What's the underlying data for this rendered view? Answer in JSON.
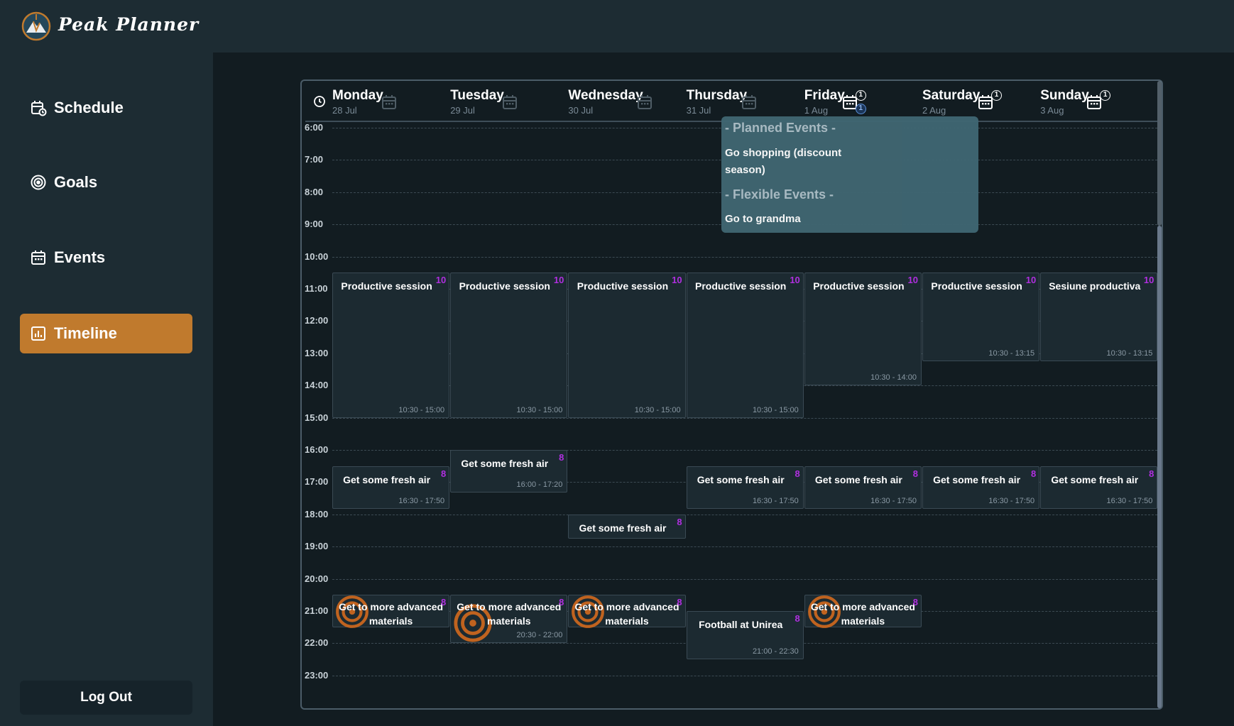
{
  "app": {
    "brand": "Peak Planner"
  },
  "sidebar": {
    "items": [
      {
        "label": "Schedule",
        "icon": "calendar-clock-icon",
        "active": false
      },
      {
        "label": "Goals",
        "icon": "target-icon",
        "active": false
      },
      {
        "label": "Events",
        "icon": "calendar-icon",
        "active": false
      },
      {
        "label": "Timeline",
        "icon": "chart-icon",
        "active": true
      }
    ],
    "logout_label": "Log Out"
  },
  "timeline": {
    "days": [
      {
        "name": "Monday",
        "date": "28 Jul",
        "badge": ""
      },
      {
        "name": "Tuesday",
        "date": "29 Jul",
        "badge": ""
      },
      {
        "name": "Wednesday",
        "date": "30 Jul",
        "badge": ""
      },
      {
        "name": "Thursday",
        "date": "31 Jul",
        "badge": ""
      },
      {
        "name": "Friday",
        "date": "1 Aug",
        "badge": "1",
        "badge2": "1"
      },
      {
        "name": "Saturday",
        "date": "2 Aug",
        "badge": "1"
      },
      {
        "name": "Sunday",
        "date": "3 Aug",
        "badge": "1"
      }
    ],
    "hours": [
      "6:00",
      "7:00",
      "8:00",
      "9:00",
      "10:00",
      "11:00",
      "12:00",
      "13:00",
      "14:00",
      "15:00",
      "16:00",
      "17:00",
      "18:00",
      "19:00",
      "20:00",
      "21:00",
      "22:00",
      "23:00"
    ],
    "events": [
      {
        "day": 0,
        "start": 10.5,
        "end": 15.0,
        "title": "Productive session",
        "priority": "10",
        "time": "10:30 - 15:00"
      },
      {
        "day": 1,
        "start": 10.5,
        "end": 15.0,
        "title": "Productive session",
        "priority": "10",
        "time": "10:30 - 15:00"
      },
      {
        "day": 2,
        "start": 10.5,
        "end": 15.0,
        "title": "Productive session",
        "priority": "10",
        "time": "10:30 - 15:00"
      },
      {
        "day": 3,
        "start": 10.5,
        "end": 15.0,
        "title": "Productive session",
        "priority": "10",
        "time": "10:30 - 15:00"
      },
      {
        "day": 4,
        "start": 10.5,
        "end": 14.0,
        "title": "Productive session",
        "priority": "10",
        "time": "10:30 - 14:00"
      },
      {
        "day": 5,
        "start": 10.5,
        "end": 13.25,
        "title": "Productive session",
        "priority": "10",
        "time": "10:30 - 13:15"
      },
      {
        "day": 6,
        "start": 10.5,
        "end": 13.25,
        "title": "Sesiune productiva",
        "priority": "10",
        "time": "10:30 - 13:15"
      },
      {
        "day": 0,
        "start": 16.5,
        "end": 17.83,
        "title": "Get some fresh air",
        "priority": "8",
        "time": "16:30 - 17:50"
      },
      {
        "day": 1,
        "start": 16.0,
        "end": 17.33,
        "title": "Get some fresh air",
        "priority": "8",
        "time": "16:00 - 17:20"
      },
      {
        "day": 2,
        "start": 18.0,
        "end": 18.75,
        "title": "Get some fresh air",
        "priority": "8",
        "time": ""
      },
      {
        "day": 3,
        "start": 16.5,
        "end": 17.83,
        "title": "Get some fresh air",
        "priority": "8",
        "time": "16:30 - 17:50"
      },
      {
        "day": 4,
        "start": 16.5,
        "end": 17.83,
        "title": "Get some fresh air",
        "priority": "8",
        "time": "16:30 - 17:50"
      },
      {
        "day": 5,
        "start": 16.5,
        "end": 17.83,
        "title": "Get some fresh air",
        "priority": "8",
        "time": "16:30 - 17:50"
      },
      {
        "day": 6,
        "start": 16.5,
        "end": 17.83,
        "title": "Get some fresh air",
        "priority": "8",
        "time": "16:30 - 17:50"
      },
      {
        "day": 0,
        "start": 20.5,
        "end": 21.5,
        "title": "Get to more advanced materials",
        "priority": "8",
        "time": "",
        "goal": true
      },
      {
        "day": 1,
        "start": 20.5,
        "end": 22.0,
        "title": "Get to more advanced materials",
        "priority": "8",
        "time": "20:30 - 22:00",
        "goal": true
      },
      {
        "day": 2,
        "start": 20.5,
        "end": 21.5,
        "title": "Get to more advanced materials",
        "priority": "8",
        "time": "",
        "goal": true
      },
      {
        "day": 3,
        "start": 21.0,
        "end": 22.5,
        "title": "Football at Unirea",
        "priority": "8",
        "time": "21:00 - 22:30"
      },
      {
        "day": 4,
        "start": 20.5,
        "end": 21.5,
        "title": "Get to more advanced materials",
        "priority": "8",
        "time": "",
        "goal": true
      }
    ]
  },
  "tooltip": {
    "planned_header": "- Planned Events -",
    "planned_items": [
      "Go shopping (discount season)"
    ],
    "flexible_header": "- Flexible Events -",
    "flexible_items": [
      "Go to grandma"
    ]
  },
  "colors": {
    "accent": "#c07a2d",
    "priority": "#b02fe0",
    "tooltip": "#406672"
  }
}
